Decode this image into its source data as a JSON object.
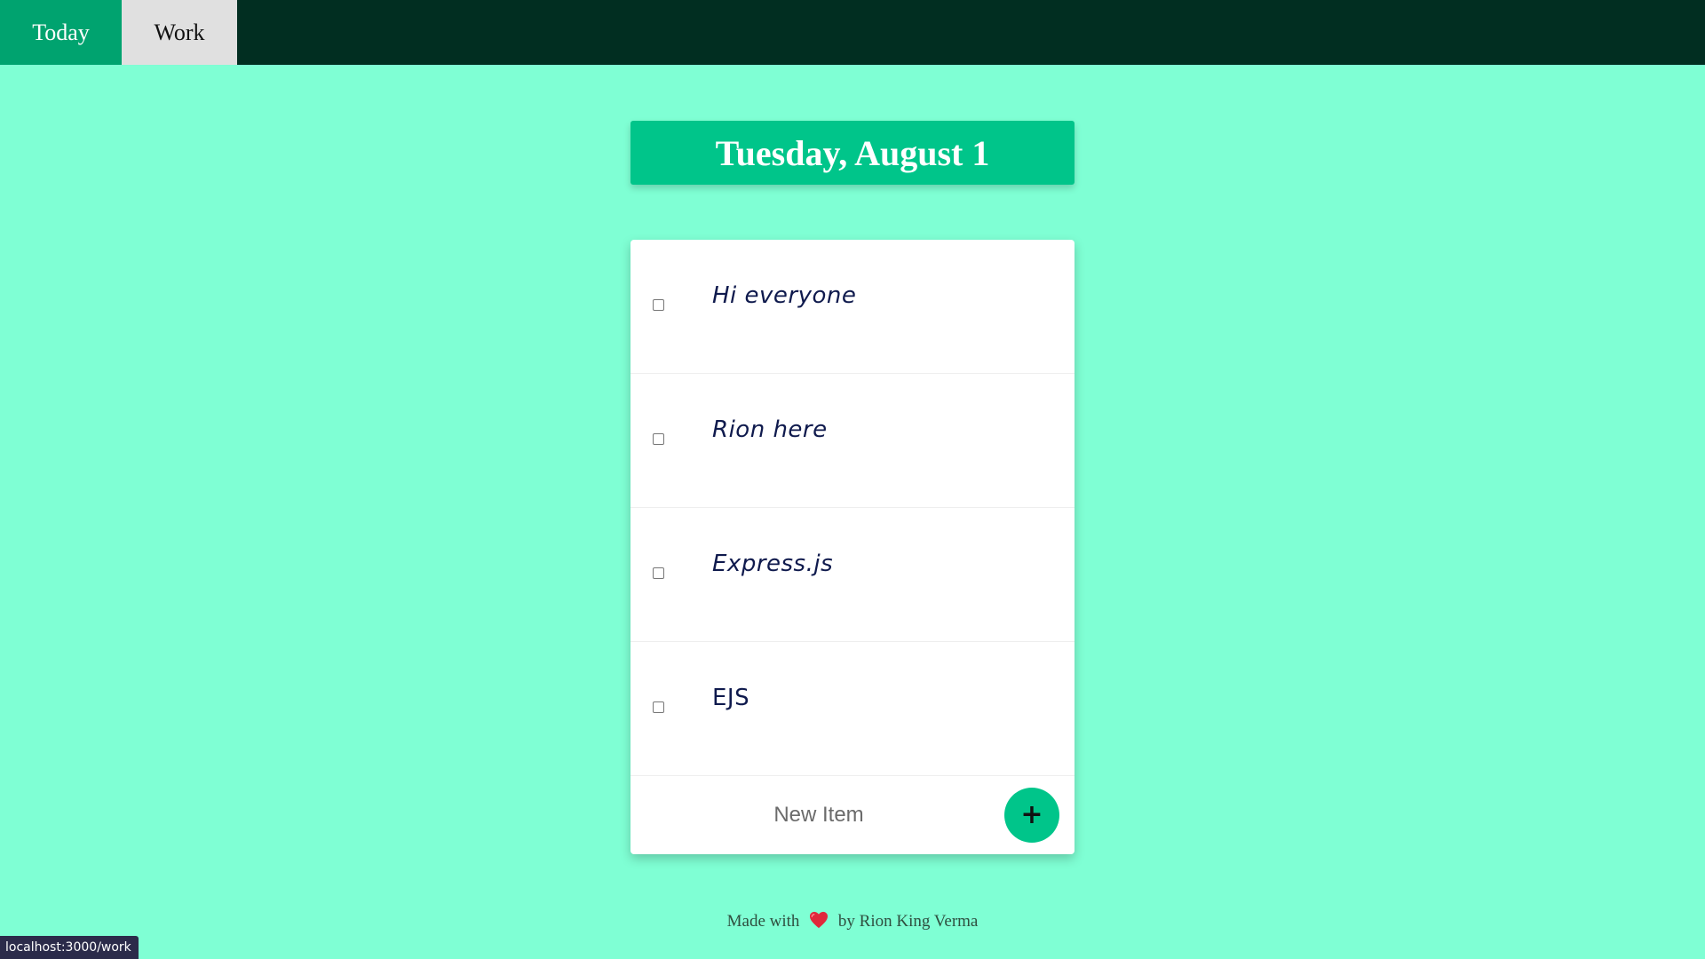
{
  "nav": {
    "tabs": [
      {
        "label": "Today",
        "active": true
      },
      {
        "label": "Work",
        "active": false
      }
    ]
  },
  "header": {
    "date": "Tuesday, August 1"
  },
  "list": {
    "items": [
      {
        "text": "Hi everyone",
        "checked": false
      },
      {
        "text": "Rion here",
        "checked": false
      },
      {
        "text": "Express.js",
        "checked": false
      },
      {
        "text": "EJS",
        "checked": false
      }
    ],
    "new_item_placeholder": "New Item",
    "add_button_label": "+"
  },
  "footer": {
    "prefix": "Made with",
    "heart_icon": "heart-icon",
    "suffix": "by Rion King Verma"
  },
  "status_bar": {
    "url": "localhost:3000/work"
  },
  "colors": {
    "background": "#7fffd4",
    "navbar": "#012e21",
    "accent": "#00c58a",
    "active_tab": "#00a36f",
    "inactive_tab": "#e0e0e0"
  }
}
